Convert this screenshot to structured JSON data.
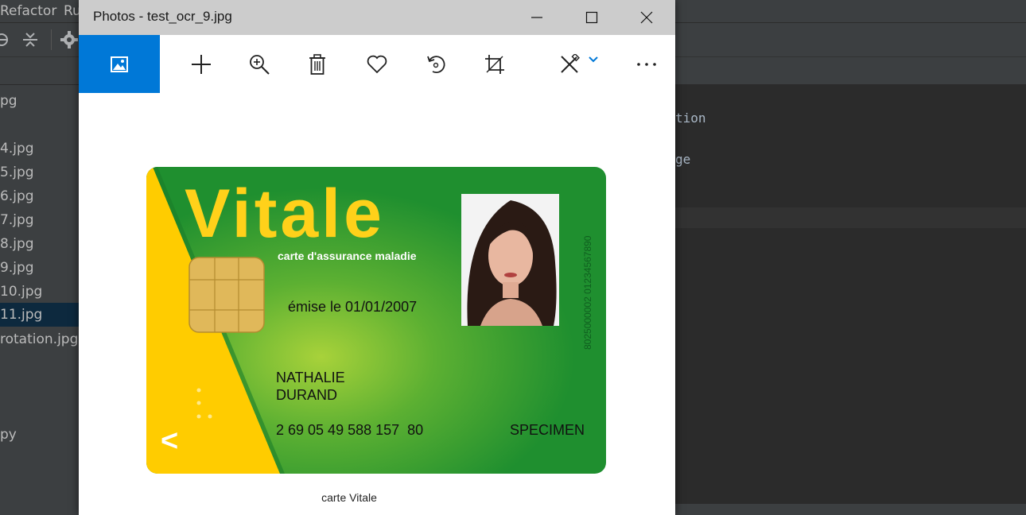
{
  "ide": {
    "menu": [
      "Refactor",
      "Ru"
    ],
    "project_files": [
      "pg",
      "4.jpg",
      "5.jpg",
      "6.jpg",
      "7.jpg",
      "8.jpg",
      "9.jpg",
      "10.jpg",
      "11.jpg",
      "rotation.jpg",
      "py"
    ],
    "selected_file_index": 8,
    "code_fragments": [
      "tion",
      "ge"
    ]
  },
  "window": {
    "title": "Photos - test_ocr_9.jpg",
    "controls": [
      "minimize",
      "maximize",
      "close"
    ]
  },
  "toolbar": {
    "items": [
      "see-all-photos-icon",
      "add-icon",
      "zoom-icon",
      "delete-icon",
      "favorite-icon",
      "rotate-icon",
      "crop-icon",
      "edit-icon",
      "more-icon"
    ],
    "accent": "#0078d7"
  },
  "card": {
    "brand": "Vitale",
    "subtitle": "carte d'assurance maladie",
    "issued": "émise le 01/01/2007",
    "first_name": "NATHALIE",
    "last_name": "DURAND",
    "number": "2 69 05 49 588 157  80",
    "specimen": "SPECIMEN",
    "serial": "8025000002 01234567890",
    "arrow": "<",
    "green": "#2f9d2f",
    "yellow": "#ffcc00"
  },
  "caption": "carte Vitale"
}
